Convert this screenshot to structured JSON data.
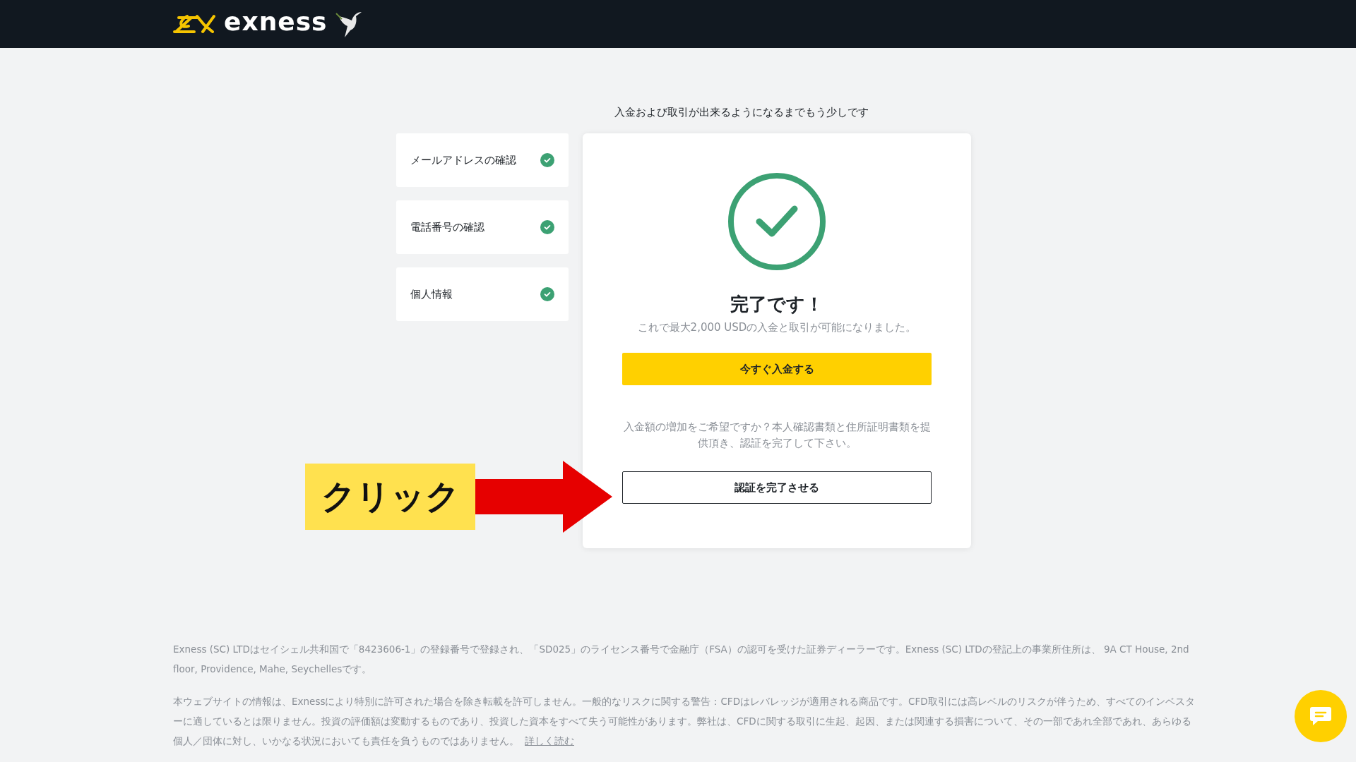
{
  "header": {
    "logo_text": "exness"
  },
  "intro": "入金および取引が出来るようになるまでもう少しです",
  "steps": [
    {
      "label": "メールアドレスの確認",
      "done": true
    },
    {
      "label": "電話番号の確認",
      "done": true
    },
    {
      "label": "個人情報",
      "done": true
    }
  ],
  "card": {
    "title": "完了です！",
    "message": "これで最大2,000 USDの入金と取引が可能になりました。",
    "primary_button": "今すぐ入金する",
    "help_text": "入金額の増加をご希望ですか？本人確認書類と住所証明書類を提供頂き、認証を完了して下さい。",
    "secondary_button": "認証を完了させる"
  },
  "callout": {
    "label": "クリック"
  },
  "footer": {
    "paragraphs": [
      "Exness (SC) LTDはセイシェル共和国で「8423606-1」の登録番号で登録され、「SD025」のライセンス番号で金融庁（FSA）の認可を受けた証券ディーラーです。Exness (SC) LTDの登記上の事業所住所は、 9A CT House, 2nd floor, Providence, Mahe, Seychellesです。",
      "本ウェブサイトの情報は、Exnessにより特別に許可された場合を除き転載を許可しません。一般的なリスクに関する警告：CFDはレバレッジが適用される商品です。CFD取引には高レベルのリスクが伴うため、すべてのインベスターに適しているとは限りません。投資の評価額は変動するものであり、投資した資本をすべて失う可能性があります。弊社は、CFDに関する取引に生起、起因、または関連する損害について、その一部であれ全部であれ、あらゆる個人／団体に対し、いかなる状況においても責任を負うものではありません。"
    ],
    "link": "詳しく読む"
  }
}
